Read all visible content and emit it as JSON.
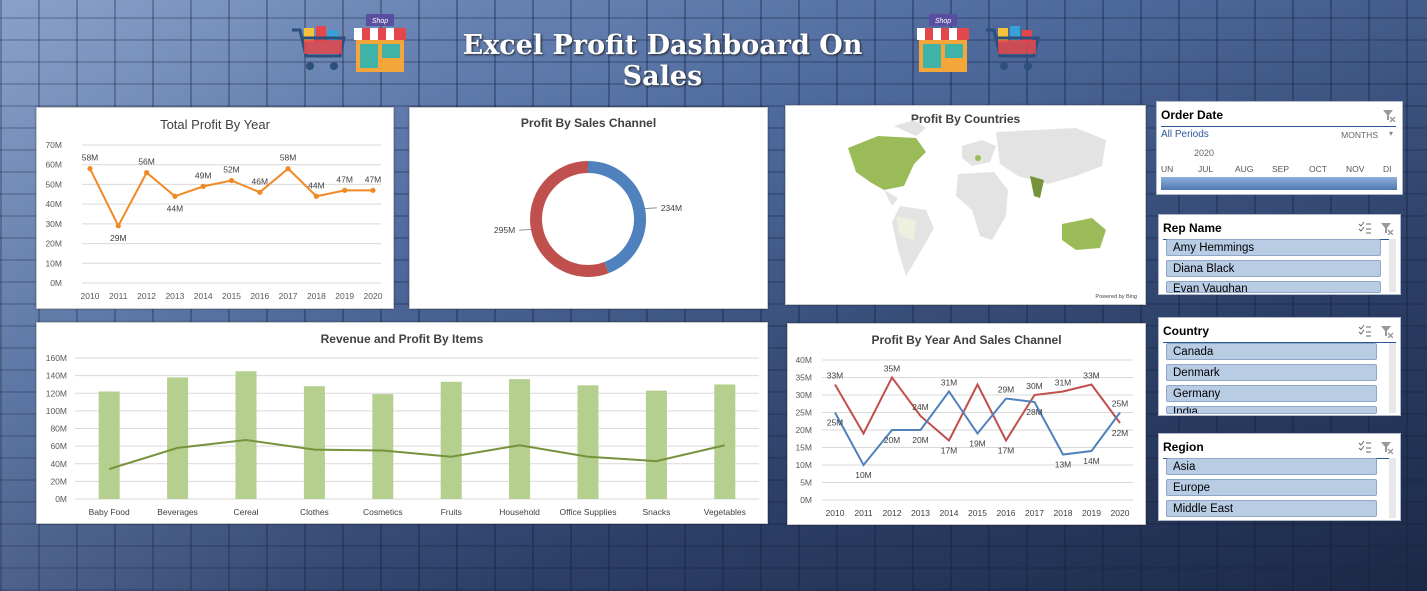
{
  "header": {
    "title": "Excel Profit Dashboard On Sales"
  },
  "colors": {
    "orange": "#f08a24",
    "blue": "#4f81bd",
    "red": "#c0504d",
    "green_bar": "#b5cf8e",
    "green_line": "#76933c"
  },
  "icons": [
    "shopping-cart-icon",
    "shop-icon"
  ],
  "shop_label": "Shop",
  "chart_data": [
    {
      "type": "line",
      "title": "Total Profit By Year",
      "x": [
        "2010",
        "2011",
        "2012",
        "2013",
        "2014",
        "2015",
        "2016",
        "2017",
        "2018",
        "2019",
        "2020"
      ],
      "values": [
        58,
        29,
        56,
        44,
        49,
        52,
        46,
        58,
        44,
        47,
        47
      ],
      "labels": [
        "58M",
        "29M",
        "56M",
        "44M",
        "49M",
        "52M",
        "46M",
        "58M",
        "44M",
        "47M",
        "47M"
      ],
      "y_ticks": [
        "70M",
        "60M",
        "50M",
        "40M",
        "30M",
        "20M",
        "10M",
        "0M"
      ],
      "ylim": [
        0,
        70
      ],
      "grid": true
    },
    {
      "type": "pie",
      "title": "Profit By Sales Channel",
      "values": [
        234,
        295
      ],
      "labels": [
        "234M",
        "295M"
      ],
      "colors": [
        "#4f81bd",
        "#c0504d"
      ]
    },
    {
      "type": "bar",
      "title": "Revenue and Profit By Items",
      "categories": [
        "Baby Food",
        "Beverages",
        "Cereal",
        "Clothes",
        "Cosmetics",
        "Fruits",
        "Household",
        "Office Supplies",
        "Snacks",
        "Vegetables"
      ],
      "series": [
        {
          "values": [
            122,
            138,
            145,
            128,
            119,
            133,
            136,
            129,
            123,
            130
          ]
        },
        {
          "values": [
            34,
            58,
            67,
            56,
            55,
            48,
            61,
            48,
            43,
            61
          ]
        }
      ],
      "y_ticks": [
        "160M",
        "140M",
        "120M",
        "100M",
        "80M",
        "60M",
        "40M",
        "20M",
        "0M"
      ],
      "ylim": [
        0,
        160
      ],
      "grid": true
    },
    {
      "type": "line",
      "title": "Profit By Year And Sales Channel",
      "x": [
        "2010",
        "2011",
        "2012",
        "2013",
        "2014",
        "2015",
        "2016",
        "2017",
        "2018",
        "2019",
        "2020"
      ],
      "series": [
        {
          "values": [
            33,
            19,
            35,
            24,
            17,
            33,
            17,
            30,
            31,
            33,
            22
          ],
          "labels": [
            "33M",
            "",
            "35M",
            "24M",
            "17M",
            "",
            "17M",
            "30M",
            "31M",
            "33M",
            "22M"
          ]
        },
        {
          "values": [
            25,
            10,
            20,
            20,
            31,
            19,
            29,
            28,
            13,
            14,
            25
          ],
          "labels": [
            "25M",
            "10M",
            "20M",
            "20M",
            "31M",
            "19M",
            "29M",
            "28M",
            "13M",
            "14M",
            "25M"
          ]
        }
      ],
      "y_ticks": [
        "40M",
        "35M",
        "30M",
        "25M",
        "20M",
        "15M",
        "10M",
        "5M",
        "0M"
      ],
      "ylim": [
        0,
        40
      ],
      "grid": true
    }
  ],
  "map": {
    "title": "Profit By Countries",
    "credit": "Powered by Bing"
  },
  "order_date": {
    "title": "Order Date",
    "periods": "All Periods",
    "unit": "MONTHS",
    "year": "2020",
    "months": [
      "UN",
      "JUL",
      "AUG",
      "SEP",
      "OCT",
      "NOV",
      "DI"
    ]
  },
  "slicers": {
    "rep": {
      "title": "Rep Name",
      "items": [
        "Amy Hemmings",
        "Diana Black",
        "Evan Vaughan"
      ]
    },
    "country": {
      "title": "Country",
      "items": [
        "Canada",
        "Denmark",
        "Germany",
        "India"
      ]
    },
    "region": {
      "title": "Region",
      "items": [
        "Asia",
        "Europe",
        "Middle East"
      ]
    }
  }
}
